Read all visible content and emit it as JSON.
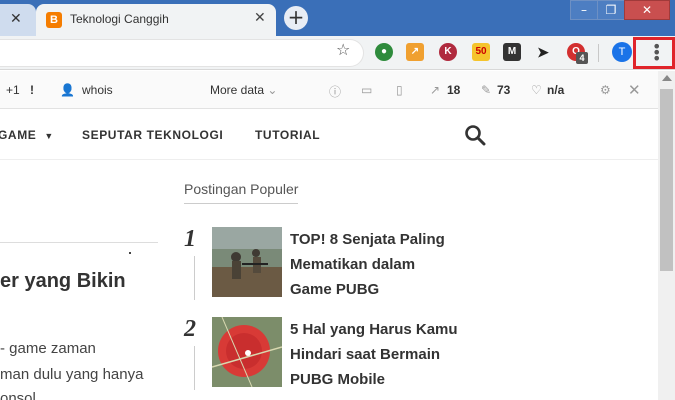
{
  "browser": {
    "tabs": [
      {
        "label": ""
      },
      {
        "label": "Teknologi Canggih",
        "favicon": "B"
      }
    ],
    "new_tab": "+",
    "window_controls": {
      "min": "–",
      "max": "❐",
      "close": "✕"
    },
    "toolbar": {
      "star": "☆",
      "extensions": [
        {
          "name": "globe-extension",
          "glyph": "●"
        },
        {
          "name": "chart-extension",
          "glyph": "↗"
        },
        {
          "name": "k-extension",
          "glyph": "K"
        },
        {
          "name": "seo-extension",
          "glyph": "50"
        },
        {
          "name": "m-extension",
          "glyph": "M"
        },
        {
          "name": "cursor-extension",
          "glyph": "➤"
        },
        {
          "name": "opera-extension",
          "glyph": "O",
          "badge": "4"
        }
      ],
      "profile_initial": "T",
      "menu_glyph": "⋮"
    }
  },
  "seobar": {
    "plus_one": "+1",
    "exclaim": "!",
    "whois": "whois",
    "more_data": "More data",
    "backlinks": "18",
    "pages": "73",
    "rank": "n/a"
  },
  "site": {
    "nav": [
      "GAME",
      "SEPUTAR TEKNOLOGI",
      "TUTORIAL"
    ],
    "left_article": {
      "title": "er yang Bikin",
      "lines": [
        "- game zaman",
        "man dulu yang hanya",
        "onsol"
      ]
    },
    "popular": {
      "heading": "Postingan Populer",
      "posts": [
        {
          "num": "1",
          "lines": [
            "TOP! 8 Senjata Paling",
            "Mematikan dalam",
            "Game PUBG"
          ]
        },
        {
          "num": "2",
          "lines": [
            "5 Hal yang Harus Kamu",
            "Hindari saat Bermain",
            "PUBG Mobile"
          ]
        }
      ]
    }
  },
  "colors": {
    "titlebar": "#3a6fb8",
    "menu_highlight": "#e0242a",
    "blogger_orange": "#f57d00"
  }
}
